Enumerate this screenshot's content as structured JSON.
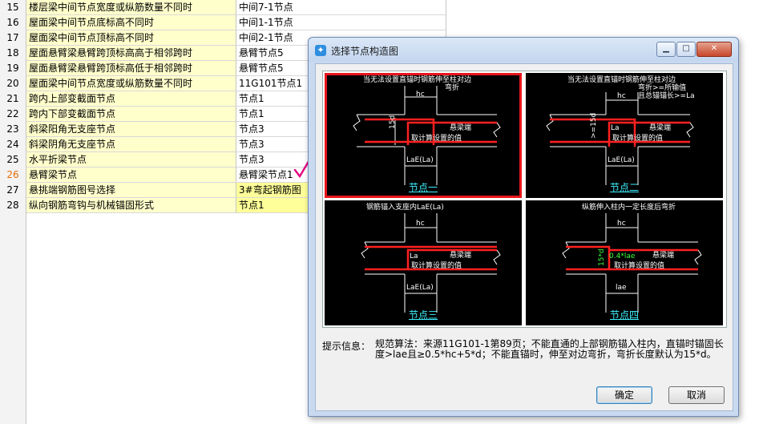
{
  "grid": {
    "rows": [
      {
        "num": "15",
        "name": "楼层梁中间节点宽度或纵筋数量不同时",
        "value": "中间7-1节点"
      },
      {
        "num": "16",
        "name": "屋面梁中间节点底标高不同时",
        "value": "中间1-1节点"
      },
      {
        "num": "17",
        "name": "屋面梁中间节点顶标高不同时",
        "value": "中间2-1节点"
      },
      {
        "num": "18",
        "name": "屋面悬臂梁悬臂跨顶标高高于相邻跨时",
        "value": "悬臂节点5"
      },
      {
        "num": "19",
        "name": "屋面悬臂梁悬臂跨顶标高低于相邻跨时",
        "value": "悬臂节点5"
      },
      {
        "num": "20",
        "name": "屋面梁中间节点宽度或纵筋数量不同时",
        "value": "11G101节点1"
      },
      {
        "num": "21",
        "name": "跨内上部变截面节点",
        "value": "节点1"
      },
      {
        "num": "22",
        "name": "跨内下部变截面节点",
        "value": "节点1"
      },
      {
        "num": "23",
        "name": "斜梁阳角无支座节点",
        "value": "节点3"
      },
      {
        "num": "24",
        "name": "斜梁阴角无支座节点",
        "value": "节点3"
      },
      {
        "num": "25",
        "name": "水平折梁节点",
        "value": "节点3"
      },
      {
        "num": "26",
        "name": "悬臂梁节点",
        "value": "悬臂梁节点1"
      },
      {
        "num": "27",
        "name": "悬挑端钢筋图号选择",
        "value": "3#弯起钢筋图"
      },
      {
        "num": "28",
        "name": "纵向钢筋弯钩与机械锚固形式",
        "value": "节点1"
      }
    ],
    "selected_row": "26"
  },
  "dialog": {
    "title": "选择节点构造图",
    "controls": {
      "min": "0",
      "max": "1",
      "close": "r"
    },
    "nodes": [
      {
        "label": "节点一",
        "header": "当无法设置直锚时钢筋伸至柱对边",
        "header2": "弯折",
        "hc": "hc",
        "dim": "15d",
        "note1": "悬梁端",
        "note2": "取计算设置的值",
        "bottom": "LaE(La)"
      },
      {
        "label": "节点二",
        "header": "当无法设置直锚时钢筋伸至柱对边",
        "header2": "弯折>=所输值",
        "header3": "且总锚锚长>=La",
        "hc": "hc",
        "dim": ">=15d",
        "la": "La",
        "note1": "悬梁端",
        "note2": "取计算设置的值",
        "bottom": "LaE(La)"
      },
      {
        "label": "节点三",
        "header": "钢筋锚入支座内LaE(La)",
        "hc": "hc",
        "la": "La",
        "note1": "悬梁端",
        "note2": "取计算设置的值",
        "bottom": "LaE(La)"
      },
      {
        "label": "节点四",
        "header": "纵筋伸入柱内一定长度后弯折",
        "hc": "hc",
        "dim": "15*d",
        "lae_frac": "0.4*lae",
        "note1": "悬梁端",
        "note2": "取计算设置的值",
        "bottom": "lae"
      }
    ],
    "hint_label": "提示信息：",
    "hint_text": "规范算法：来源11G101-1第89页；不能直通的上部钢筋锚入柱内，直锚时锚固长度>lae且≥0.5*hc+5*d；不能直锚时，伸至对边弯折，弯折长度默认为15*d。",
    "ok_label": "确定",
    "cancel_label": "取消"
  },
  "colors": {
    "selection": "#e8161b",
    "rebar": "#ff2020",
    "label": "#3ff0ff",
    "name_bg": "#ffffcc",
    "check": "#e4007f"
  }
}
